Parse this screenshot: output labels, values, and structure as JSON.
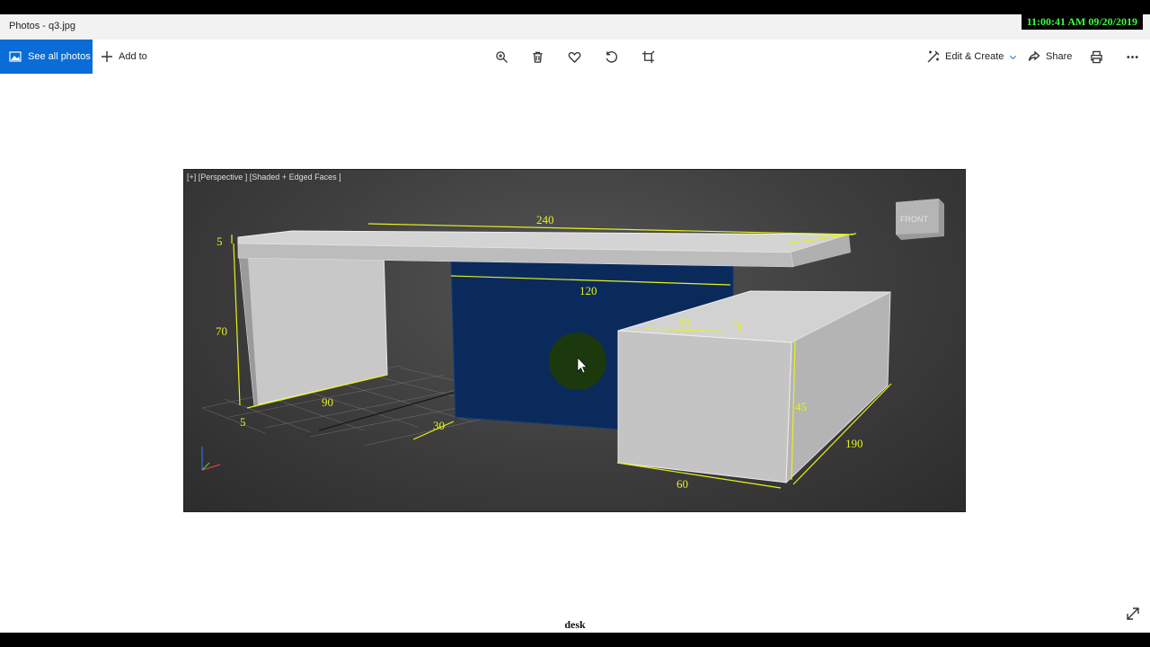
{
  "clock": "11:00:41 AM 09/20/2019",
  "window": {
    "title": "Photos - q3.jpg"
  },
  "toolbar": {
    "see_all_photos": "See all photos",
    "add_to": "Add to",
    "edit_create": "Edit & Create",
    "share": "Share",
    "icons": [
      "zoom-in-icon",
      "delete-icon",
      "favorite-heart-icon",
      "rotate-icon",
      "crop-icon",
      "print-icon",
      "more-icon"
    ]
  },
  "viewport": {
    "label": "[+] [Perspective ] [Shaded + Edged Faces ]",
    "viewcube_label": "FRONT",
    "dimensions": {
      "top_width": "240",
      "top_thickness": "5",
      "leg_height": "70",
      "leg_depth": "90",
      "leg_thickness": "5",
      "grid_offset": "30",
      "modesty_panel_width": "120",
      "cabinet_top_depth": "30",
      "cabinet_gap": "5",
      "cabinet_height": "45",
      "cabinet_width": "60",
      "cabinet_length": "190"
    }
  },
  "caption": "desk",
  "colors": {
    "accent": "#0a6cd6",
    "dimension_lines": "#e6f21a",
    "panel": "#0b2a5c",
    "clock": "#3cff3c"
  }
}
